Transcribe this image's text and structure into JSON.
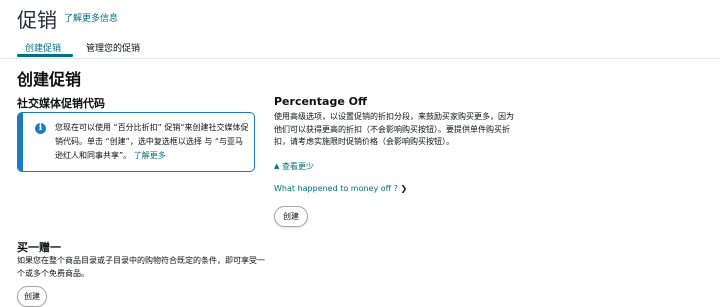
{
  "page": {
    "title": "促销",
    "learn_more": "了解更多信息"
  },
  "tabs": [
    {
      "label": "创建促销"
    },
    {
      "label": "管理您的促销"
    }
  ],
  "section_title": "创建促销",
  "social_codes": {
    "title": "社交媒体促销代码",
    "info_text": "您现在可以使用 “百分比折扣” 促销“来创建社交媒体促销代码。单击 “创建”，选中复选框以选择 与 “与亚马逊红人和同事共享”。",
    "info_link": "了解更多"
  },
  "percentage_off": {
    "title": "Percentage Off",
    "description": "使用高级选项，以设置促销的折扣分段，来鼓励买家购买更多，因为他们可以获得更高的折扣（不会影响购买按钮）。要提供单件购买折扣，请考虑实施限时促销价格（会影响购买按钮）。",
    "see_less": "查看更少",
    "money_off_link": "What happened to money off ?",
    "create_button": "创建"
  },
  "bogo": {
    "title": "买一赠一",
    "description": "如果您在整个商品目录或子目录中的购物符合既定的条件，即可享受一个或多个免费商品。",
    "create_button": "创建"
  }
}
